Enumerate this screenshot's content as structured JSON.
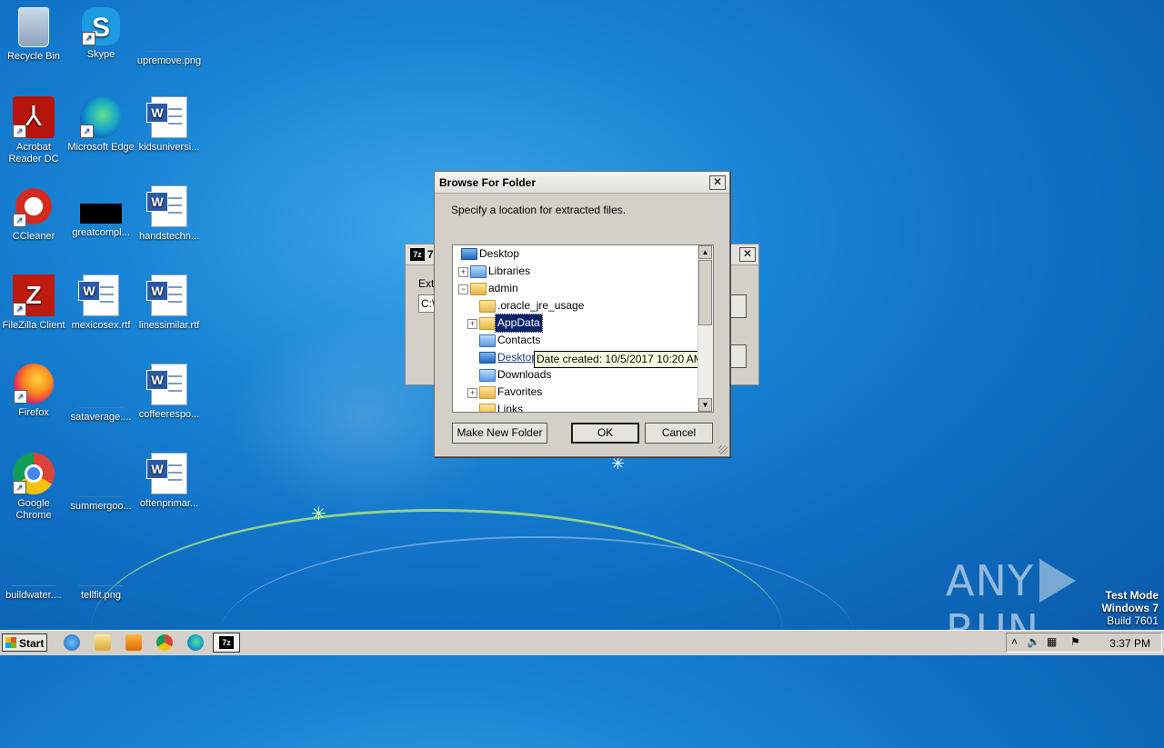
{
  "desktop_icons": [
    {
      "label": "Recycle Bin"
    },
    {
      "label": "Skype"
    },
    {
      "label": "upremove.png"
    },
    {
      "label": "Acrobat Reader DC"
    },
    {
      "label": "Microsoft Edge"
    },
    {
      "label": "kidsuniversi..."
    },
    {
      "label": "CCleaner"
    },
    {
      "label": "greatcompl..."
    },
    {
      "label": "handstechn..."
    },
    {
      "label": "FileZilla Client"
    },
    {
      "label": "mexicosex.rtf"
    },
    {
      "label": "linessimilar.rtf"
    },
    {
      "label": "Firefox"
    },
    {
      "label": "sataverage...."
    },
    {
      "label": "coffeerespo..."
    },
    {
      "label": "Google Chrome"
    },
    {
      "label": "summergoo..."
    },
    {
      "label": "oftenprimar..."
    },
    {
      "label": "buildwater...."
    },
    {
      "label": "tellfit.png"
    }
  ],
  "background_window": {
    "title_prefix": "7",
    "app_icon": "7z",
    "label_extract": "Extr",
    "path_value": "C:\\"
  },
  "dialog": {
    "title": "Browse For Folder",
    "instruction": "Specify a location for extracted files.",
    "tree": [
      {
        "label": "Desktop"
      },
      {
        "label": "Libraries"
      },
      {
        "label": "admin"
      },
      {
        "label": ".oracle_jre_usage"
      },
      {
        "label": "AppData"
      },
      {
        "label": "Contacts"
      },
      {
        "label": "Desktop"
      },
      {
        "label": "Downloads"
      },
      {
        "label": "Favorites"
      },
      {
        "label": "Links"
      }
    ],
    "tooltip": "Date created: 10/5/2017 10:20 AM",
    "buttons": {
      "make_new_folder": "Make New Folder",
      "ok": "OK",
      "cancel": "Cancel"
    }
  },
  "watermark": {
    "brand_left": "ANY",
    "brand_right": "RUN",
    "line1": "Test Mode",
    "line2": "Windows 7",
    "line3": "Build 7601"
  },
  "taskbar": {
    "start_label": "Start",
    "clock": "3:37 PM",
    "active_app_icon": "7z"
  }
}
